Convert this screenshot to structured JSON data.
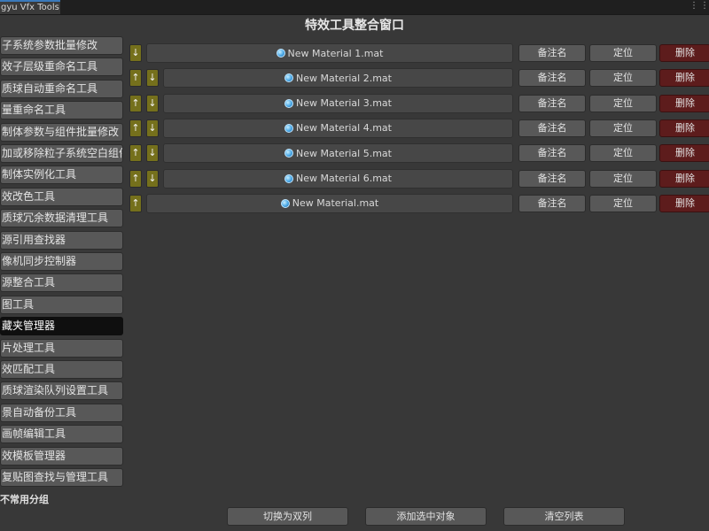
{
  "tab": {
    "title": "gyu Vfx Tools"
  },
  "window_title": "特效工具整合窗口",
  "sidebar": {
    "items": [
      {
        "label": "子系统参数批量修改"
      },
      {
        "label": "效子层级重命名工具"
      },
      {
        "label": "质球自动重命名工具"
      },
      {
        "label": "量重命名工具"
      },
      {
        "label": "制体参数与组件批量修改"
      },
      {
        "label": "加或移除粒子系统空白组件"
      },
      {
        "label": "制体实例化工具"
      },
      {
        "label": "效改色工具"
      },
      {
        "label": "质球冗余数据清理工具"
      },
      {
        "label": "源引用查找器"
      },
      {
        "label": "像机同步控制器"
      },
      {
        "label": "源整合工具"
      },
      {
        "label": "图工具"
      },
      {
        "label": "藏夹管理器",
        "active": true
      },
      {
        "label": "片处理工具"
      },
      {
        "label": "效匹配工具"
      },
      {
        "label": "质球渲染队列设置工具"
      },
      {
        "label": "景自动备份工具"
      },
      {
        "label": "画帧编辑工具"
      },
      {
        "label": "效模板管理器"
      },
      {
        "label": "复贴图查找与管理工具"
      }
    ],
    "group_label": "不常用分组"
  },
  "favorites": {
    "rows": [
      {
        "name": "New Material 1.mat",
        "up": false,
        "down": true
      },
      {
        "name": "New Material 2.mat",
        "up": true,
        "down": true
      },
      {
        "name": "New Material 3.mat",
        "up": true,
        "down": true
      },
      {
        "name": "New Material 4.mat",
        "up": true,
        "down": true
      },
      {
        "name": "New Material 5.mat",
        "up": true,
        "down": true
      },
      {
        "name": "New Material 6.mat",
        "up": true,
        "down": true
      },
      {
        "name": "New Material.mat",
        "up": true,
        "down": false
      }
    ],
    "labels": {
      "note": "备注名",
      "locate": "定位",
      "delete": "删除"
    },
    "arrows": {
      "up": "↑",
      "down": "↓"
    }
  },
  "bottom": {
    "toggle_label": "切换为双列",
    "add_label": "添加选中对象",
    "clear_label": "清空列表"
  },
  "colors": {
    "background": "#383838",
    "button": "#585858",
    "active_item": "#0f0f0f",
    "arrow_button": "#75701c",
    "delete_button": "#5d1c1c",
    "tab_accent": "#3a79bb"
  }
}
